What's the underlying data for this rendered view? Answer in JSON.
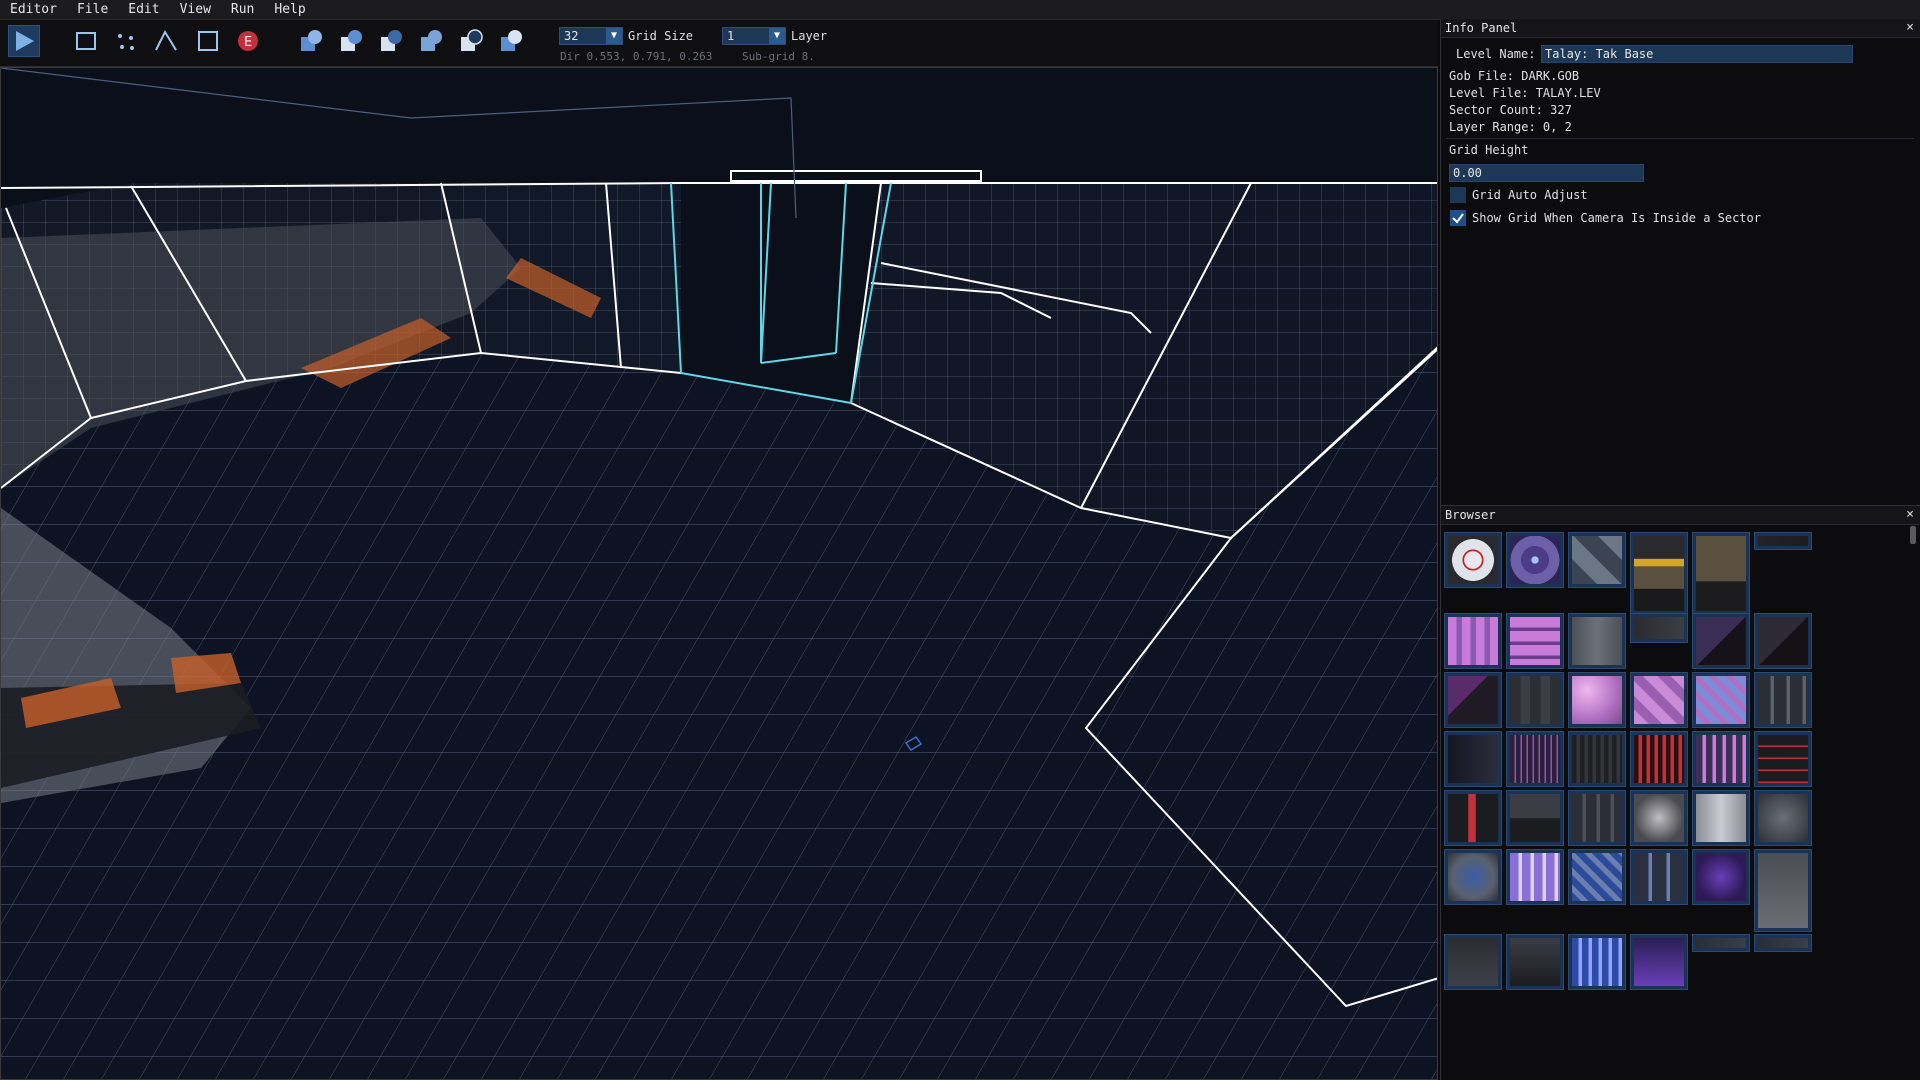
{
  "menu": [
    "Editor",
    "File",
    "Edit",
    "View",
    "Run",
    "Help"
  ],
  "toolbar": {
    "tools": [
      "play-icon",
      "draw-rect-icon",
      "vertex-mode-icon",
      "wall-mode-icon",
      "sector-mode-icon",
      "entity-mode-icon"
    ],
    "csg_tools": [
      "csg-new-icon",
      "csg-add-icon",
      "csg-subtract-icon",
      "csg-merge-icon",
      "csg-intersect-icon",
      "csg-split-icon"
    ],
    "grid_size_value": "32",
    "grid_size_label": "Grid Size",
    "layer_value": "1",
    "layer_label": "Layer",
    "dir_readout": "Dir 0.553, 0.791, 0.263",
    "subgrid_readout": "Sub-grid 8."
  },
  "info_panel": {
    "title": "Info Panel",
    "level_name_label": "Level Name:",
    "level_name_value": "Talay: Tak Base",
    "gob_file": "Gob File: DARK.GOB",
    "level_file": "Level File: TALAY.LEV",
    "sector_count": "Sector Count: 327",
    "layer_range": "Layer Range: 0, 2",
    "grid_height_label": "Grid Height",
    "grid_height_value": "0.00",
    "grid_auto_adjust_label": "Grid Auto Adjust",
    "grid_auto_adjust_checked": false,
    "show_grid_label": "Show Grid When Camera Is Inside a Sector",
    "show_grid_checked": true,
    "close": "×"
  },
  "browser": {
    "title": "Browser",
    "close": "×"
  },
  "colors": {
    "accent": "#1f3a5c",
    "grid": "#9fb4d6",
    "wire": "#ffffff",
    "selected": "#5fd7e6",
    "viewport_bg": "#0b0f1a"
  }
}
